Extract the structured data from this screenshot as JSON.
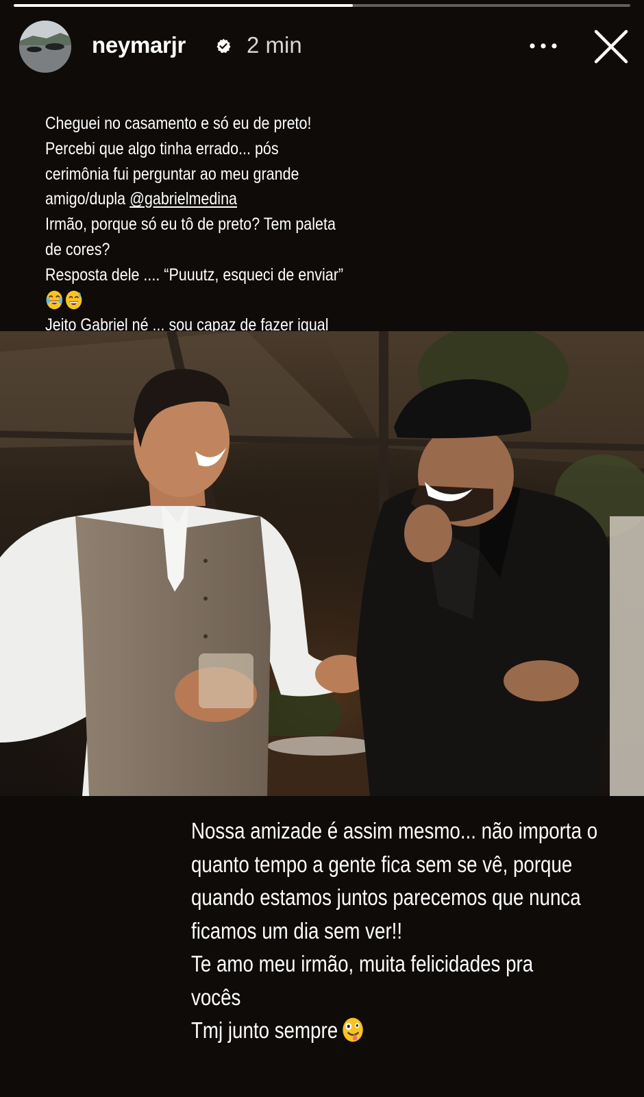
{
  "story": {
    "progress_fraction": 0.55
  },
  "header": {
    "username": "neymarjr",
    "time_ago": "2 min",
    "icons": {
      "verified": "verified-badge-icon",
      "more": "more-options-icon",
      "close": "close-icon"
    }
  },
  "caption_top": {
    "line1": "Cheguei no casamento e só eu de preto!",
    "line2": "Percebi que algo tinha errado... pós",
    "line3": "cerimônia fui perguntar ao meu grande",
    "line4_prefix": "amigo/dupla ",
    "line4_mention": "@gabrielmedina",
    "line5": "Irmão, porque só eu tô de preto? Tem paleta",
    "line6": "de cores?",
    "line7": "Resposta dele .... “Puuutz, esqueci de enviar”",
    "emojis": [
      "face-with-tears-of-joy",
      "grinning-face-with-sweat"
    ],
    "line9": "Jeito Gabriel né ... sou capaz de fazer igual"
  },
  "caption_bottom": {
    "line1": "Nossa amizade é assim mesmo... não importa o",
    "line2": "quanto tempo a gente fica sem se vê, porque",
    "line3": "quando estamos juntos parecemos que nunca",
    "line4": "ficamos um dia sem ver!!",
    "line5": "Te amo meu irmão, muita felicidades pra",
    "line6": "vocês",
    "line7": "Tmj junto sempre",
    "emoji": "zany-face"
  },
  "colors": {
    "background": "#0e0b08",
    "text": "#ffffff",
    "progress_track": "rgba(255,255,255,0.35)",
    "progress_fill": "#ffffff"
  }
}
